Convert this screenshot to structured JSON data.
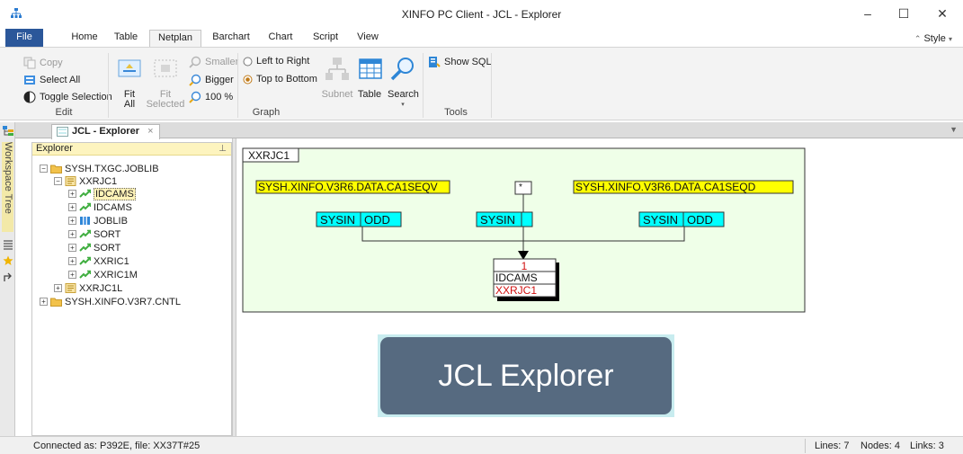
{
  "window": {
    "title": "XINFO PC Client - JCL - Explorer",
    "minimize": "–",
    "maximize": "☐",
    "close": "✕"
  },
  "ribbon_tabs": [
    "File",
    "Home",
    "Table",
    "Netplan",
    "Barchart",
    "Chart",
    "Script",
    "View"
  ],
  "active_tab": "Netplan",
  "style_button": "Style",
  "ribbon": {
    "edit": {
      "label": "Edit",
      "copy": "Copy",
      "select_all": "Select All",
      "toggle_selection": "Toggle Selection"
    },
    "graph": {
      "label": "Graph",
      "fit_all": "Fit\nAll",
      "fit_all_l1": "Fit",
      "fit_all_l2": "All",
      "fit_selected_l1": "Fit",
      "fit_selected_l2": "Selected",
      "smaller": "Smaller",
      "bigger": "Bigger",
      "zoom_100": "100 %",
      "left_to_right": "Left to Right",
      "top_to_bottom": "Top to Bottom",
      "subnet": "Subnet",
      "table": "Table",
      "search": "Search"
    },
    "tools": {
      "label": "Tools",
      "show_sql": "Show SQL"
    }
  },
  "side_strip": {
    "workspace_tree": "Workspace Tree"
  },
  "doc_tab": {
    "label": "JCL - Explorer",
    "close": "×"
  },
  "explorer": {
    "title": "Explorer",
    "pin": "ᵖ",
    "nodes": [
      {
        "label": "SYSH.TXGC.JOBLIB",
        "toggle": "−"
      },
      {
        "label": "XXRJC1",
        "toggle": "−"
      },
      {
        "label": "IDCAMS",
        "toggle": "+"
      },
      {
        "label": "IDCAMS",
        "toggle": "+"
      },
      {
        "label": "JOBLIB",
        "toggle": "+"
      },
      {
        "label": "SORT",
        "toggle": "+"
      },
      {
        "label": "SORT",
        "toggle": "+"
      },
      {
        "label": "XXRIC1",
        "toggle": "+"
      },
      {
        "label": "XXRIC1M",
        "toggle": "+"
      },
      {
        "label": "XXRJC1L",
        "toggle": "+"
      },
      {
        "label": "SYSH.XINFO.V3R7.CNTL",
        "toggle": "+"
      }
    ]
  },
  "graph": {
    "container_label": "XXRJC1",
    "datasets": [
      "SYSH.XINFO.V3R6.DATA.CA1SEQV",
      "*",
      "SYSH.XINFO.V3R6.DATA.CA1SEQD"
    ],
    "dd_left": [
      "SYSIN",
      "ODD"
    ],
    "dd_center": [
      "SYSIN",
      ""
    ],
    "dd_right": [
      "SYSIN",
      "ODD"
    ],
    "step": {
      "number": "1",
      "program": "IDCAMS",
      "job": "XXRJC1"
    },
    "banner": "JCL Explorer"
  },
  "status": {
    "connected": "Connected as: P392E, file: XX37T#25",
    "lines": "Lines: 7",
    "nodes": "Nodes: 4",
    "links": "Links: 3"
  },
  "colors": {
    "file_tab": "#2b579a",
    "dataset_fill": "#ffff00",
    "dd_fill": "#00ffff",
    "graph_bg": "#efffe8",
    "banner_bg": "#566a80"
  }
}
